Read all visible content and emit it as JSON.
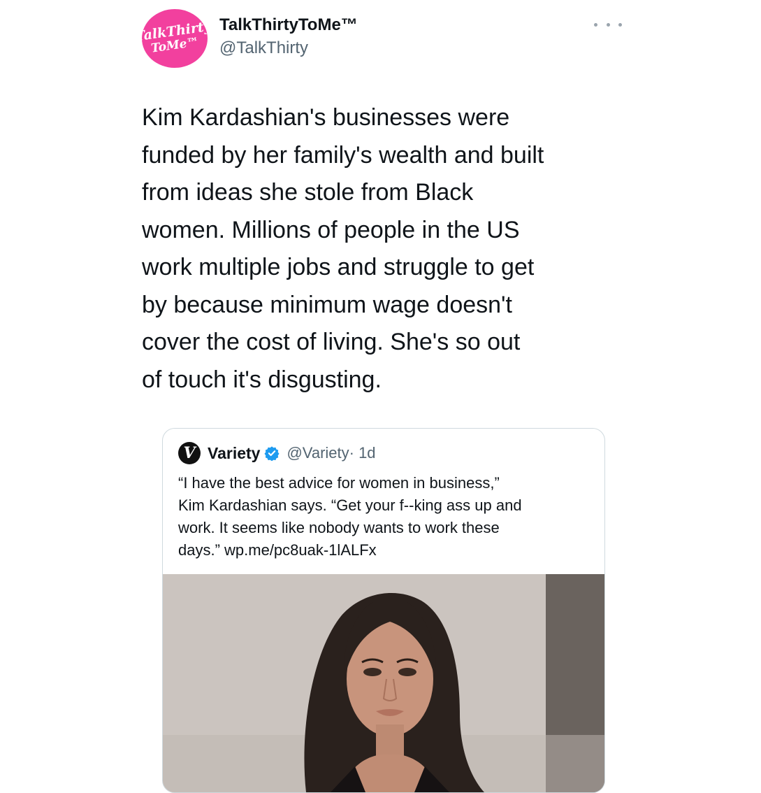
{
  "tweet": {
    "avatar_text_line1": "TalkThirty",
    "avatar_text_line2": "ToMe™",
    "display_name": "TalkThirtyToMe™",
    "handle": "@TalkThirty",
    "more_icon": "more-horizontal-icon",
    "text": "Kim Kardashian's businesses were\nfunded by her family's wealth and built\nfrom ideas she stole from Black\nwomen. Millions of people in the US\nwork multiple jobs and struggle to get\nby because minimum wage doesn't\ncover the cost of living. She's so out\nof touch it's disgusting."
  },
  "quoted_tweet": {
    "logo_text": "V",
    "display_name": "Variety",
    "verified_icon": "verified-badge-icon",
    "handle": "@Variety",
    "time": " · 1d",
    "text": "“I have the best advice for women in business,”\nKim Kardashian says. “Get your f--king ass up and\nwork. It seems like nobody wants to work these\ndays.” wp.me/pc8uak-1lALFx",
    "media": "photo of a woman with long dark hair"
  },
  "colors": {
    "avatar_pink": "#f2409e",
    "text_primary": "#0f1419",
    "text_secondary": "#536471",
    "verified_blue": "#1d9bf0",
    "card_border": "#cfd9de"
  }
}
